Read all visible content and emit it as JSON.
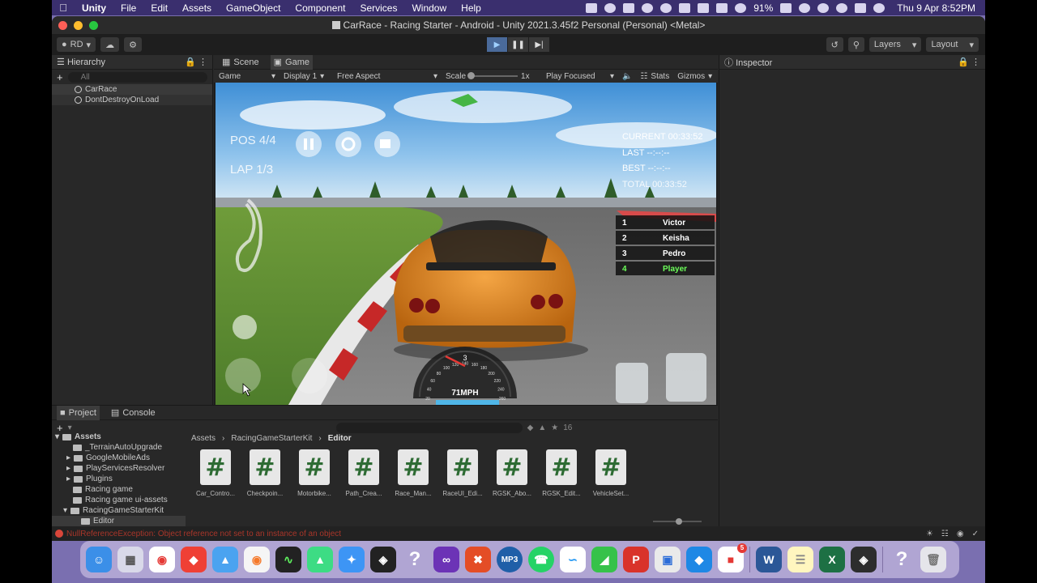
{
  "menubar": {
    "app": "Unity",
    "items": [
      "File",
      "Edit",
      "Assets",
      "GameObject",
      "Component",
      "Services",
      "Window",
      "Help"
    ],
    "battery": "91%",
    "clock": "Thu 9 Apr  8:52PM"
  },
  "window": {
    "title": "CarRace - Racing Starter - Android - Unity 2021.3.45f2 Personal (Personal) <Metal>"
  },
  "toolbar": {
    "account": "RD",
    "layers_label": "Layers",
    "layout_label": "Layout"
  },
  "hierarchy": {
    "title": "Hierarchy",
    "search_placeholder": "All",
    "items": [
      "CarRace",
      "DontDestroyOnLoad"
    ]
  },
  "gameview": {
    "tabs": [
      "Scene",
      "Game"
    ],
    "mode": "Game",
    "display": "Display 1",
    "aspect": "Free Aspect",
    "scale_label": "Scale",
    "scale_value": "1x",
    "play_focus": "Play Focused",
    "stats": "Stats",
    "gizmos": "Gizmos"
  },
  "hud": {
    "pos": "POS 4/4",
    "lap": "LAP 1/3",
    "current": "CURRENT 00:33:52",
    "last": "LAST --:--:--",
    "best": "BEST --:--:--",
    "total": "TOTAL 00:33:52",
    "leaderboard": [
      {
        "rank": "1",
        "name": "Victor"
      },
      {
        "rank": "2",
        "name": "Keisha"
      },
      {
        "rank": "3",
        "name": "Pedro"
      },
      {
        "rank": "4",
        "name": "Player"
      }
    ],
    "gear": "3",
    "speed": "71MPH",
    "dial_ticks": [
      "20",
      "40",
      "60",
      "80",
      "100",
      "120",
      "140",
      "160",
      "180",
      "200",
      "220",
      "240",
      "260"
    ]
  },
  "inspector": {
    "title": "Inspector"
  },
  "project": {
    "tabs": [
      "Project",
      "Console"
    ],
    "count": "16",
    "tree": [
      {
        "label": "Assets",
        "level": 0
      },
      {
        "label": "_TerrainAutoUpgrade",
        "level": 1
      },
      {
        "label": "GoogleMobileAds",
        "level": 1
      },
      {
        "label": "PlayServicesResolver",
        "level": 1
      },
      {
        "label": "Plugins",
        "level": 1
      },
      {
        "label": "Racing game",
        "level": 1
      },
      {
        "label": "Racing game ui-assets",
        "level": 1
      },
      {
        "label": "RacingGameStarterKit",
        "level": 1
      },
      {
        "label": "Editor",
        "level": 2
      }
    ],
    "breadcrumb": [
      "Assets",
      "RacingGameStarterKit",
      "Editor"
    ],
    "files": [
      "Car_Contro...",
      "Checkpoin...",
      "Motorbike...",
      "Path_Crea...",
      "Race_Man...",
      "RaceUI_Edi...",
      "RGSK_Abo...",
      "RGSK_Edit...",
      "VehicleSet..."
    ],
    "file_glyph": "#"
  },
  "status": {
    "error": "NullReferenceException: Object reference not set to an instance of an object"
  },
  "dock": {
    "icons": [
      "finder-icon",
      "launchpad-icon",
      "chrome-icon",
      "anydesk-icon",
      "maps-icon",
      "blender-icon",
      "activity-monitor-icon",
      "android-studio-icon",
      "safari-icon",
      "unity-hub-icon",
      "help-icon",
      "visual-studio-icon",
      "remote-icon",
      "mp3-icon",
      "whatsapp-icon",
      "freeform-icon",
      "camo-icon",
      "powerpoint-icon",
      "preview-icon",
      "app-icon",
      "office-icon",
      "word-icon",
      "notes-icon",
      "excel-icon",
      "unity-icon",
      "help-icon-2",
      "trash-icon"
    ],
    "labels": {
      "mp3": "MP3",
      "word": "W",
      "excel": "X",
      "ppt": "P",
      "help": "?",
      "badge": "5"
    }
  }
}
